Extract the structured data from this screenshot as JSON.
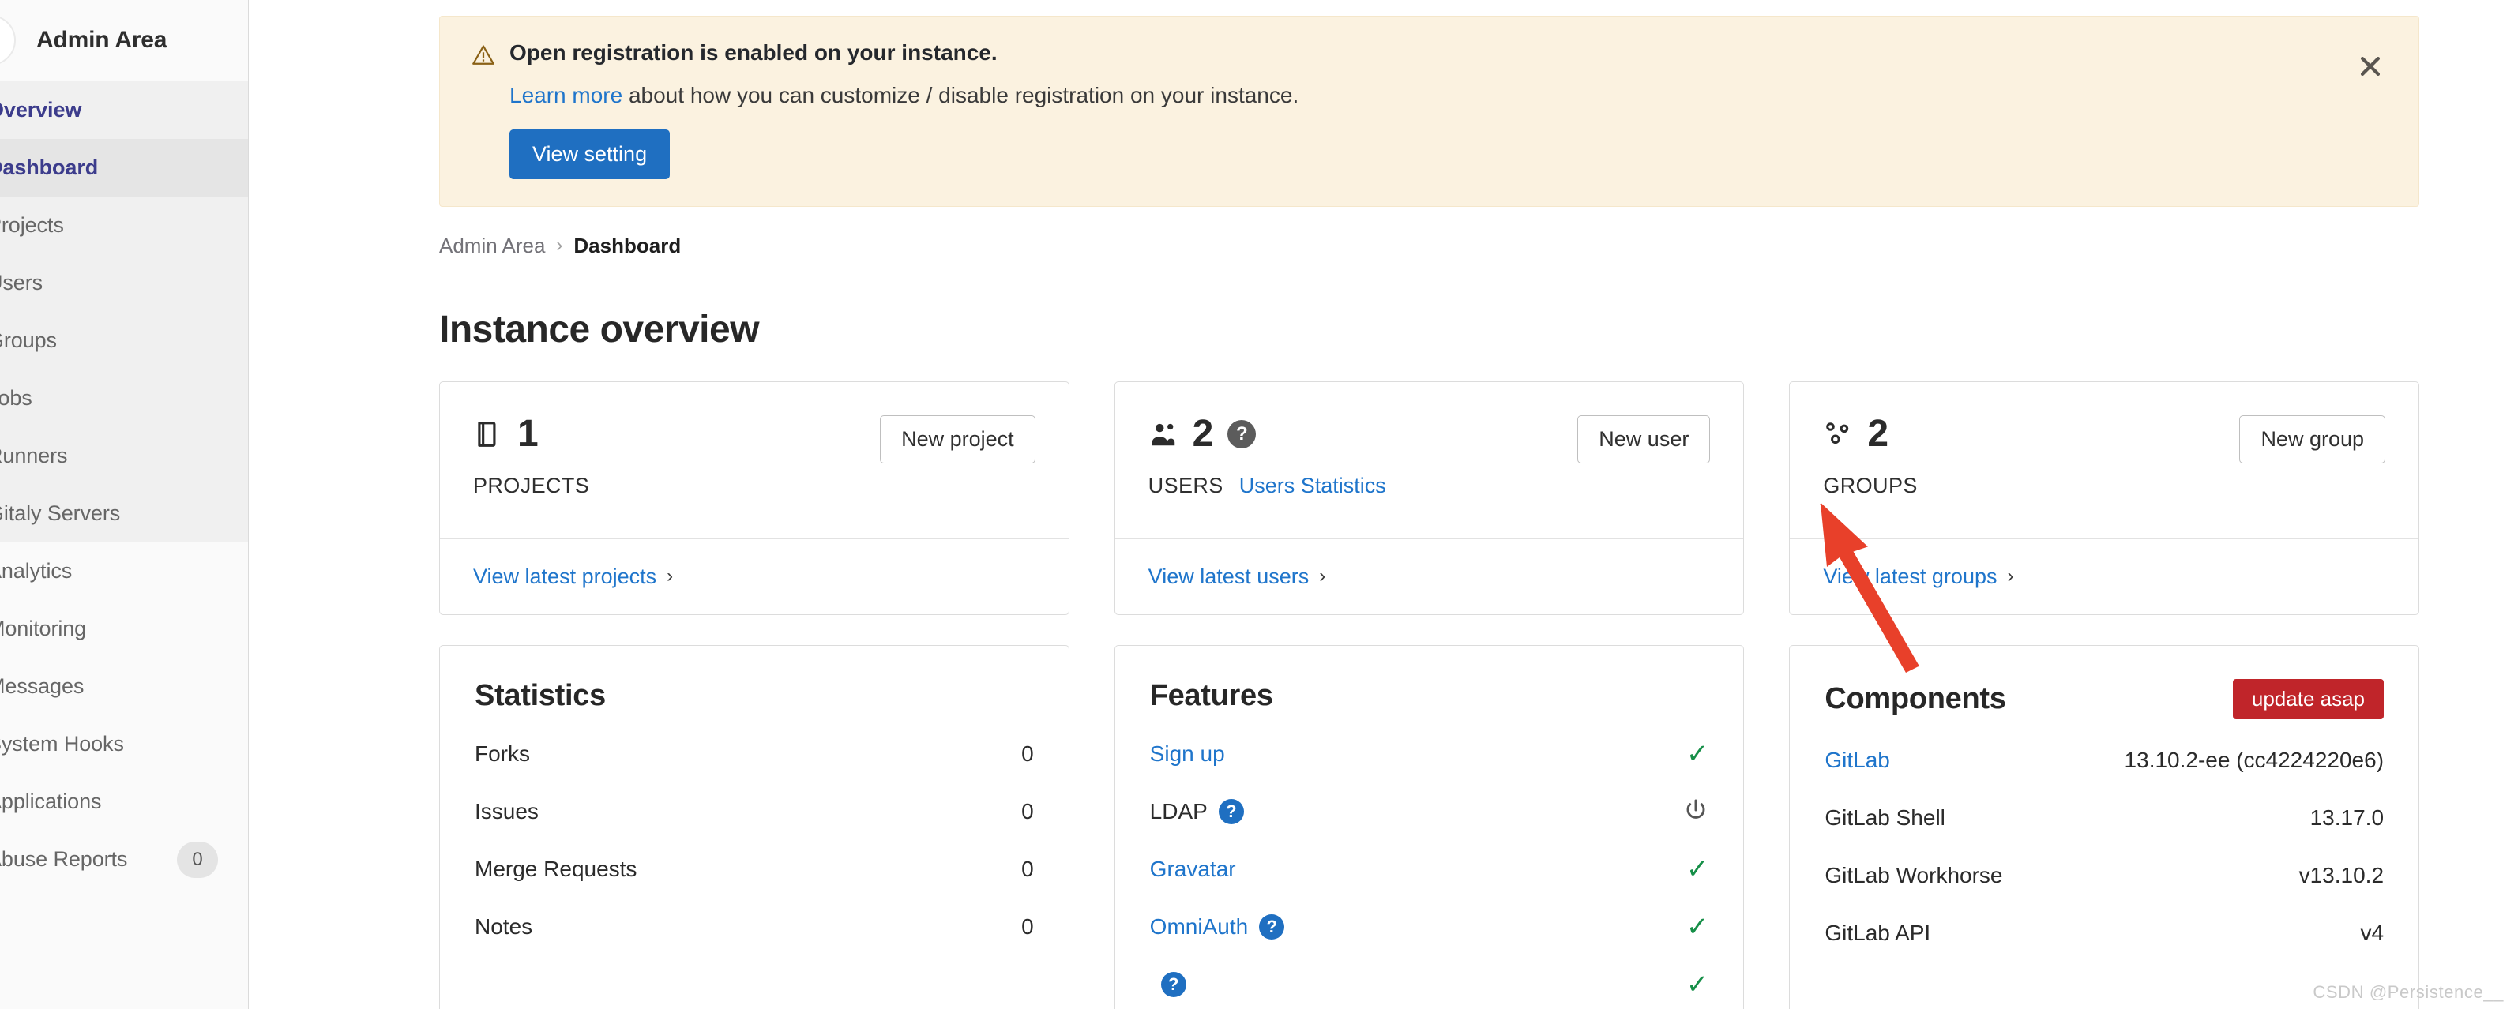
{
  "sidebar": {
    "title": "Admin Area",
    "groups": [
      {
        "shaded": true,
        "items": [
          {
            "label": "Overview",
            "accent": true,
            "active": false
          },
          {
            "label": "Dashboard",
            "accent": true,
            "active": true
          },
          {
            "label": "Projects",
            "accent": false,
            "active": false
          },
          {
            "label": "Users",
            "accent": false,
            "active": false
          },
          {
            "label": "Groups",
            "accent": false,
            "active": false
          },
          {
            "label": "Jobs",
            "accent": false,
            "active": false
          },
          {
            "label": "Runners",
            "accent": false,
            "active": false
          },
          {
            "label": "Gitaly Servers",
            "accent": false,
            "active": false
          }
        ]
      },
      {
        "shaded": false,
        "items": [
          {
            "label": "Analytics",
            "accent": false,
            "active": false
          },
          {
            "label": "Monitoring",
            "accent": false,
            "active": false
          },
          {
            "label": "Messages",
            "accent": false,
            "active": false
          },
          {
            "label": "System Hooks",
            "accent": false,
            "active": false
          },
          {
            "label": "Applications",
            "accent": false,
            "active": false
          },
          {
            "label": "Abuse Reports",
            "accent": false,
            "active": false,
            "badge": "0"
          }
        ]
      }
    ]
  },
  "alert": {
    "icon": "warning-triangle-icon",
    "title": "Open registration is enabled on your instance.",
    "body_link": "Learn more",
    "body_text": " about how you can customize / disable registration on your instance.",
    "button_label": "View setting",
    "close_icon": "close-icon",
    "bg_color": "#fbf2e0",
    "button_color": "#1f6fc1"
  },
  "breadcrumb": {
    "root": "Admin Area",
    "separator": "›",
    "current": "Dashboard"
  },
  "page": {
    "title": "Instance overview"
  },
  "stat_cards": [
    {
      "icon": "project-icon",
      "count": "1",
      "label": "PROJECTS",
      "sublink": "",
      "has_help": false,
      "action_label": "New project",
      "footer_label": "View latest projects",
      "footer_chevron": "›"
    },
    {
      "icon": "users-icon",
      "count": "2",
      "label": "USERS",
      "sublink": "Users Statistics",
      "has_help": true,
      "action_label": "New user",
      "footer_label": "View latest users",
      "footer_chevron": "›"
    },
    {
      "icon": "group-icon",
      "count": "2",
      "label": "GROUPS",
      "sublink": "",
      "has_help": false,
      "action_label": "New group",
      "footer_label": "View latest groups",
      "footer_chevron": "›"
    }
  ],
  "statistics_panel": {
    "title": "Statistics",
    "rows": [
      {
        "label": "Forks",
        "value": "0"
      },
      {
        "label": "Issues",
        "value": "0"
      },
      {
        "label": "Merge Requests",
        "value": "0"
      },
      {
        "label": "Notes",
        "value": "0"
      }
    ]
  },
  "features_panel": {
    "title": "Features",
    "rows": [
      {
        "label": "Sign up",
        "is_link": true,
        "help": false,
        "status": "check"
      },
      {
        "label": "LDAP",
        "is_link": false,
        "help": true,
        "status": "power"
      },
      {
        "label": "Gravatar",
        "is_link": true,
        "help": false,
        "status": "check"
      },
      {
        "label": "OmniAuth",
        "is_link": true,
        "help": true,
        "status": "check"
      },
      {
        "label": "",
        "is_link": true,
        "help": true,
        "status": "check"
      }
    ]
  },
  "components_panel": {
    "title": "Components",
    "badge": "update asap",
    "badge_color": "#c0252a",
    "rows": [
      {
        "label": "GitLab",
        "is_link": true,
        "value": "13.10.2-ee (cc4224220e6)"
      },
      {
        "label": "GitLab Shell",
        "is_link": false,
        "value": "13.17.0"
      },
      {
        "label": "GitLab Workhorse",
        "is_link": false,
        "value": "v13.10.2"
      },
      {
        "label": "GitLab API",
        "is_link": false,
        "value": "v4"
      }
    ]
  },
  "annotation": {
    "arrow_color": "#e8402a"
  },
  "watermark": {
    "text": "CSDN @Persistence__"
  }
}
